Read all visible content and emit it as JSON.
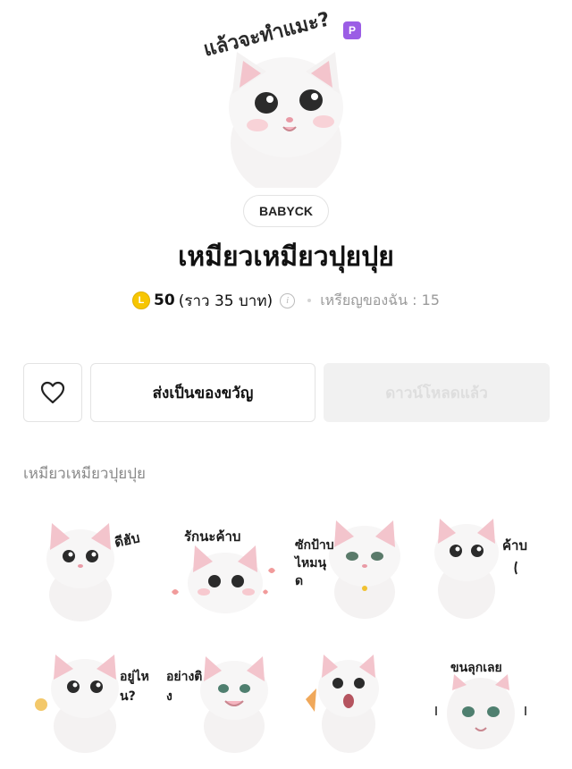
{
  "hero": {
    "caption": "แล้วจะทำแมะ?",
    "premium_badge": "P"
  },
  "author": "BABYCK",
  "title": "เหมียวเหมียวปุยปุย",
  "price": {
    "coin_icon": "L",
    "amount": "50",
    "baht": "(ราว 35 บาท)",
    "info_icon": "i",
    "my_coins": "เหรียญของฉัน : 15"
  },
  "buttons": {
    "favorite_icon": "heart-icon",
    "gift_label": "ส่งเป็นของขวัญ",
    "downloaded_label": "ดาวน์โหลดแล้ว"
  },
  "section_label": "เหมียวเหมียวปุยปุย",
  "stickers": [
    {
      "caption": "ดีฮับ"
    },
    {
      "caption": "รักนะค้าบ"
    },
    {
      "caption": "ซักป้าบไหมนุด"
    },
    {
      "caption": "ค้าบ"
    },
    {
      "caption": "อยู่ไหน?"
    },
    {
      "caption": "อย่างติง"
    },
    {
      "caption": ""
    },
    {
      "caption": "ขนลุกเลย"
    }
  ],
  "colors": {
    "premium": "#9b5de5",
    "coin": "#f7c600",
    "disabled_bg": "#f1f1f1"
  }
}
